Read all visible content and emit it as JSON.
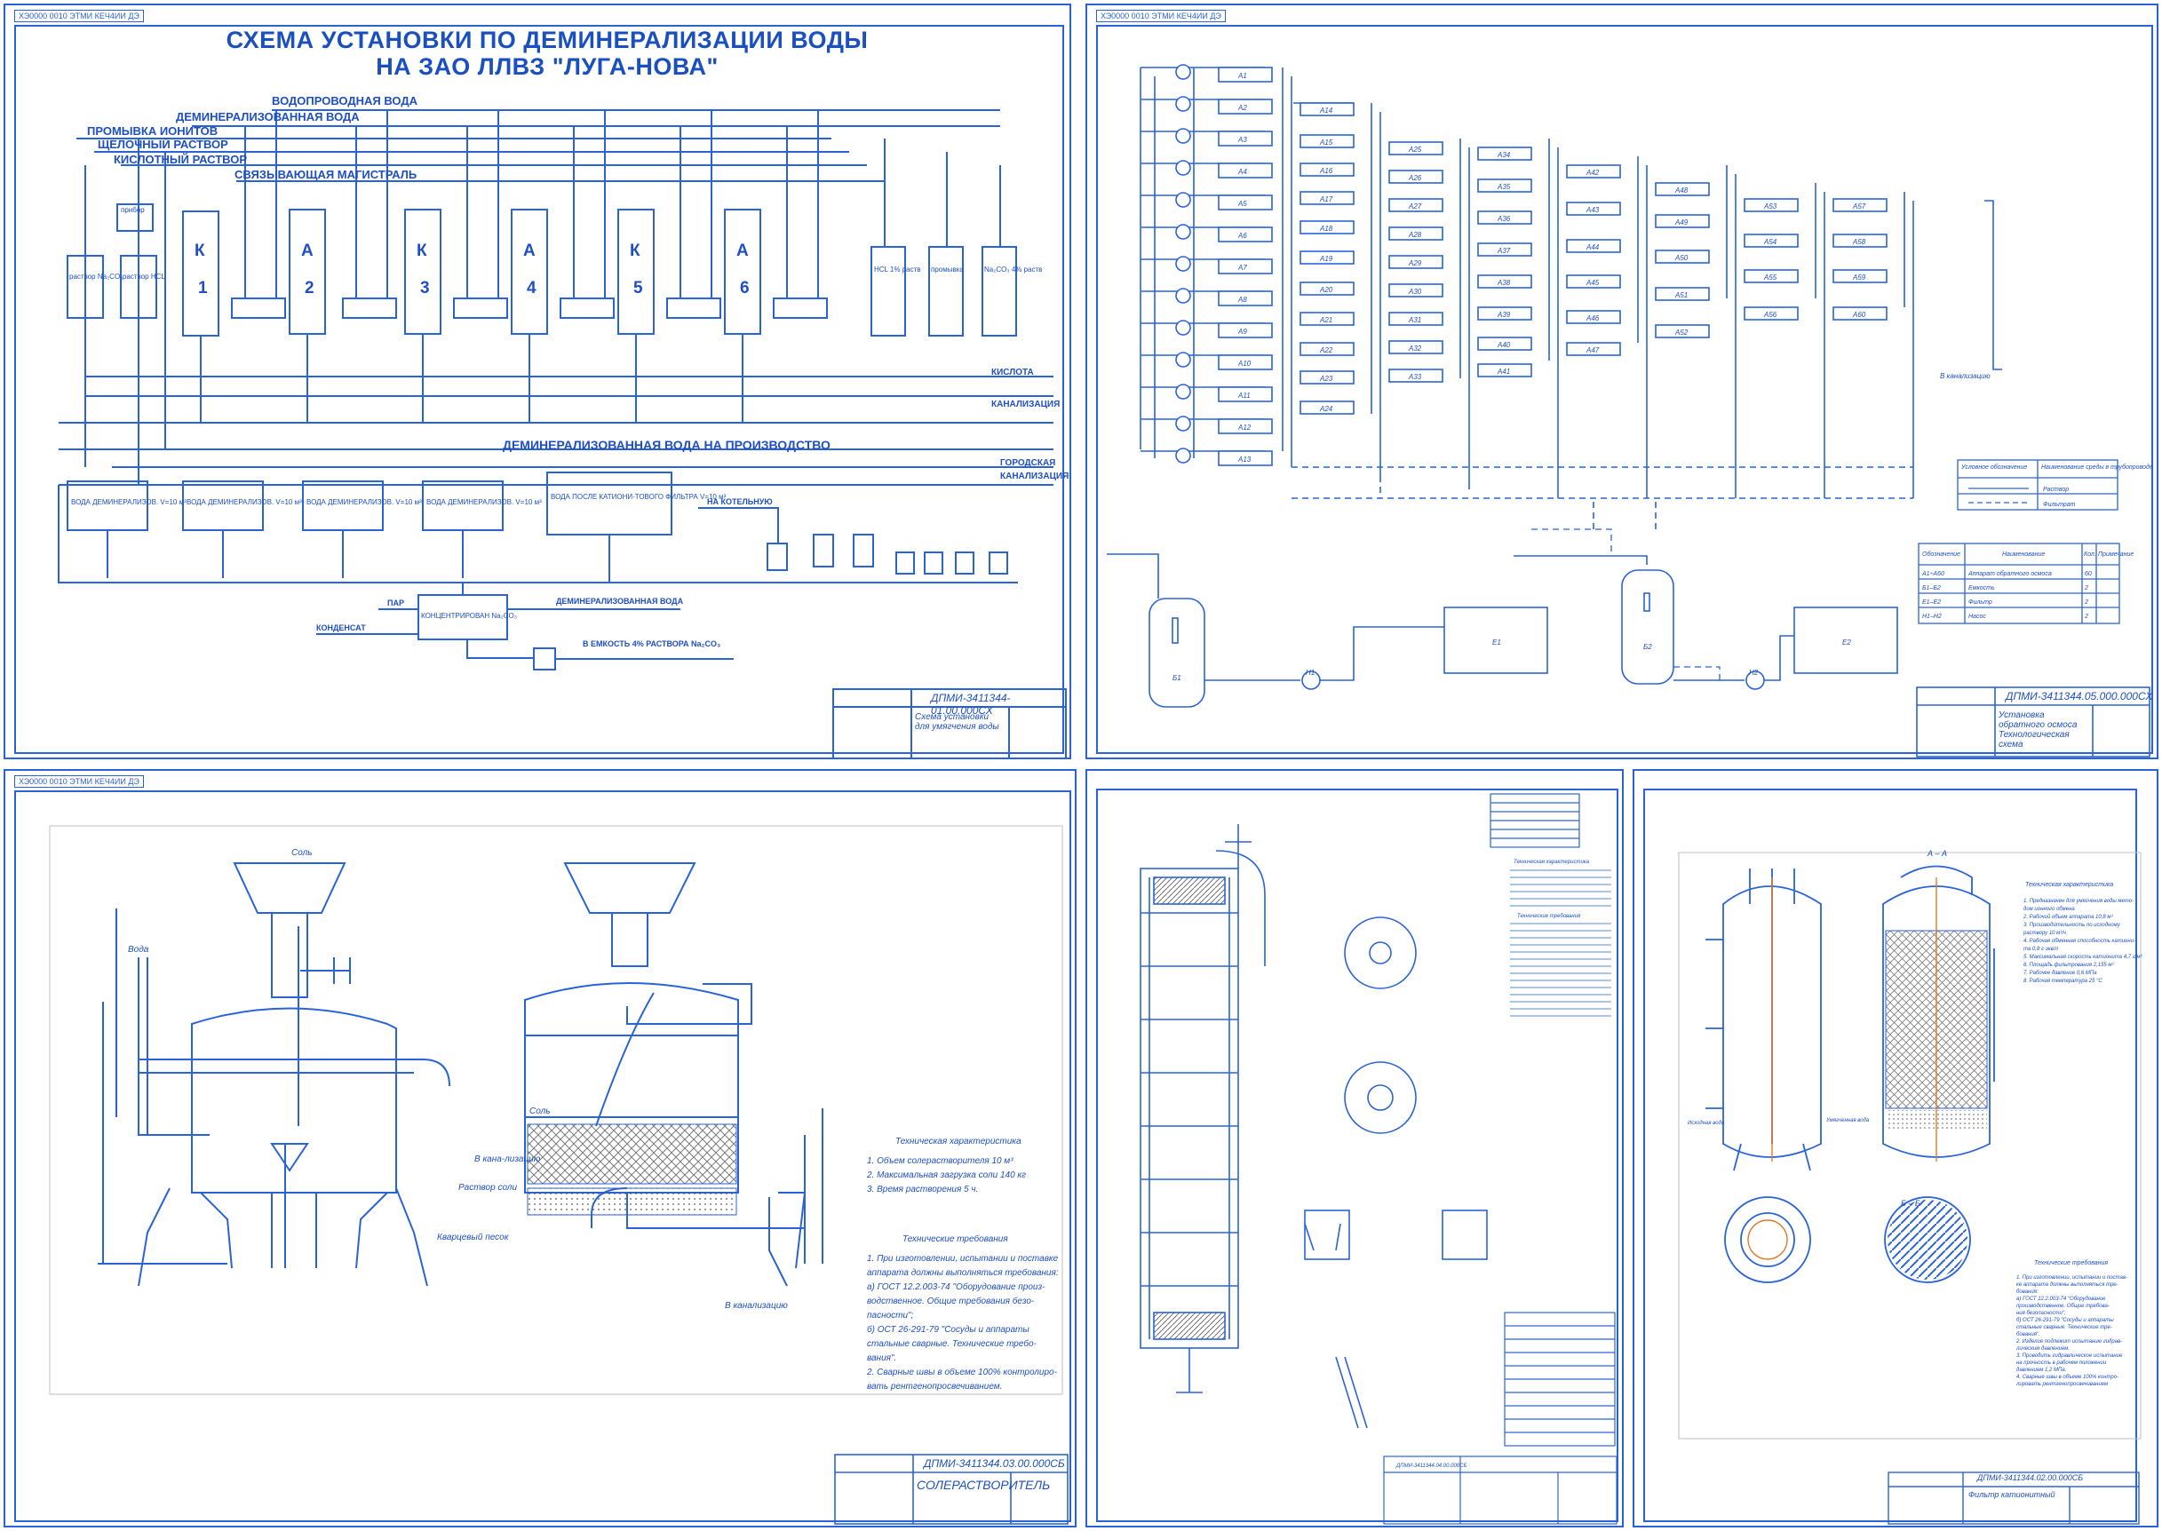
{
  "sheets": [
    {
      "stamp": "ХЭ0000 0010 ЭТМИ КЕЧ4ИИ ДЭ",
      "title_line1": "СХЕМА УСТАНОВКИ ПО ДЕМИНЕРАЛИЗАЦИИ ВОДЫ",
      "title_line2": "НА ЗАО ЛЛВЗ \"ЛУГА-НОВА\"",
      "lines": [
        "ВОДОПРОВОДНАЯ ВОДА",
        "ДЕМИНЕРАЛИЗОВАННАЯ ВОДА",
        "ПРОМЫВКА ИОНИТОВ",
        "ЩЕЛОЧНЫЙ РАСТВОР",
        "КИСЛОТНЫЙ РАСТВОР",
        "СВЯЗЫВАЮЩАЯ МАГИСТРАЛЬ"
      ],
      "columns": [
        "К",
        "1",
        "А",
        "2",
        "К",
        "3",
        "А",
        "4",
        "К",
        "5",
        "А",
        "6"
      ],
      "tanks_left": [
        "прибор",
        "раствор Na₂CO₃",
        "раствор HCL"
      ],
      "tanks_right": [
        "HCL 1% раств",
        "промывка",
        "Na₂CO₃ 4% раств"
      ],
      "kislota": "КИСЛОТА",
      "kanalizaciya": "КАНАЛИЗАЦИЯ",
      "demin_production": "ДЕМИНЕРАЛИЗОВАННАЯ ВОДА НА ПРОИЗВОДСТВО",
      "gorodskaya": "ГОРОДСКАЯ",
      "kanalizaciya2": "КАНАЛИЗАЦИЯ",
      "boxes": [
        "ВОДА ДЕМИНЕРАЛИЗОВ. V=10 м³",
        "ВОДА ДЕМИНЕРАЛИЗОВ. V=10 м³",
        "ВОДА ДЕМИНЕРАЛИЗОВ. V=10 м³",
        "ВОДА ДЕМИНЕРАЛИЗОВ. V=10 м³",
        "ВОДА ПОСЛЕ КАТИОНИ-ТОВОГО ФИЛЬТРА V=10 м³"
      ],
      "na_kotelnuyu": "НА КОТЕЛЬНУЮ",
      "par": "ПАР",
      "konc": "КОНЦЕНТРИРОВАН Na₂CO₃",
      "demin_water": "ДЕМИНЕРАЛИЗОВАННАЯ ВОДА",
      "kondensat": "КОНДЕНСАТ",
      "v_emkost": "В ЕМКОСТЬ 4% РАСТВОРА Na₂CO₃",
      "code": "ДПМИ-3411344-01.00.000СХ",
      "name": "Схема установки для умягчения воды"
    },
    {
      "stamp": "ХЭ0000 0010 ЭТМИ КЕЧ4ИИ ДЭ",
      "units_col1": [
        "А1",
        "А2",
        "А3",
        "А4",
        "А5",
        "А6",
        "А7",
        "А8",
        "А9",
        "А10",
        "А11",
        "А12",
        "А13"
      ],
      "units_col2": [
        "А14",
        "А15",
        "А16",
        "А17",
        "А18",
        "А19",
        "А20",
        "А21",
        "А22",
        "А23",
        "А24"
      ],
      "units_col3": [
        "А25",
        "А26",
        "А27",
        "А28",
        "А29",
        "А30",
        "А31",
        "А32",
        "А33"
      ],
      "units_col4": [
        "А34",
        "А35",
        "А36",
        "А37",
        "А38",
        "А39",
        "А40",
        "А41"
      ],
      "units_col5": [
        "А42",
        "А43",
        "А44",
        "А45",
        "А46",
        "А47"
      ],
      "units_col6": [
        "А48",
        "А49",
        "А50",
        "А51",
        "А52"
      ],
      "units_col7": [
        "А53",
        "А54",
        "А55",
        "А56"
      ],
      "units_col8": [
        "А57",
        "А58",
        "А59",
        "А60"
      ],
      "to_sewer": "В канализацию",
      "legend_head": [
        "Условное обозначение",
        "Наименование среды в трубопроводе"
      ],
      "legend_rows": [
        "Раствор",
        "Фильтрат"
      ],
      "spec_head": [
        "Обозначение",
        "Наименование",
        "Кол.",
        "Примечание"
      ],
      "spec_rows": [
        [
          "А1÷А60",
          "Аппарат обратного осмоса",
          "60"
        ],
        [
          "Б1–Б2",
          "Емкость",
          "2"
        ],
        [
          "Е1–Е2",
          "Фильтр",
          "2"
        ],
        [
          "Н1–Н2",
          "Насос",
          "2"
        ]
      ],
      "equip": [
        "Б1",
        "Н1",
        "Е1",
        "Б2",
        "Н2",
        "Е2"
      ],
      "code": "ДПМИ-3411344.05.000.000СХ",
      "name": "Установка обратного осмоса Технологическая схема"
    },
    {
      "stamp": "ХЭ0000 0010 ЭТМИ КЕЧ4ИИ ДЭ",
      "sol": "Соль",
      "voda": "Вода",
      "v_kanal": "В кана-лизацию",
      "rastvor_soli": "Раствор соли",
      "kvarc": "Кварцевый песок",
      "sol2": "Соль",
      "v_kanal2": "В канализацию",
      "tech_char_title": "Техническая характеристика",
      "tech_char": [
        "1. Объем солерастворителя 10 м³",
        "2. Максимальная загрузка соли 140 кг",
        "3. Время растворения 5 ч."
      ],
      "tech_req_title": "Технические требования",
      "tech_req": [
        "1. При изготовлении, испытании и поставке",
        "аппарата должны выполняться требования:",
        "а) ГОСТ 12.2.003-74 \"Оборудование произ-",
        "водственное. Общие требования безо-",
        "пасности\";",
        "б) ОСТ 26-291-79 \"Сосуды и аппараты",
        "стальные сварные. Технические требо-",
        "вания\".",
        "2. Сварные швы в объеме 100% контролиро-",
        "вать рентгенопросвечиванием."
      ],
      "code": "ДПМИ-3411344.03.00.000СБ",
      "name": "СОЛЕРАСТВОРИТЕЛЬ"
    },
    {
      "tech_title": "Техническая характеристика",
      "tech_req_title": "Технические требования",
      "code": "ДПМИ-3411344.04.00.000СБ"
    },
    {
      "section_aa": "А – А",
      "section_bb": "Б – Б",
      "tech_title": "Техническая характеристика",
      "tech_items": [
        "1. Предназначен для умягчения воды мето-",
        "дом ионного обмена",
        "2. Рабочий объем аппарата 10,8 м³",
        "3. Производительность по исходному",
        "раствору 10 м³/ч",
        "4. Рабочая обменная способность катиони-",
        "та 0,8 г·экв/л",
        "5. Максимальная скорость катионита 4,7 г/м³",
        "6. Площадь фильтрования 2,155 м²",
        "7. Рабочее давление 0,6 МПа",
        "8. Рабочая температура 25 °С"
      ],
      "tech_req_title": "Технические требования",
      "tech_req": [
        "1. При изготовлении, испытании и постав-",
        "ке аппарата должны выполняться тре-",
        "бования:",
        "а) ГОСТ 12.2.003-74 \"Оборудование",
        "производственное. Общие требова-",
        "ния безопасности\";",
        "б) ОСТ 26-291-79 \"Сосуды и аппараты",
        "стальные сварные. Технические тре-",
        "бования\".",
        "2. Изделие подлежит испытанию гидрав-",
        "лическим давлением.",
        "3. Проводить гидравлическое испытание",
        "на прочность в рабочем положении",
        "давлением 1,2 МПа.",
        "4. Сварные швы в объеме 100% контро-",
        "лировать рентгенопросвечиванием"
      ],
      "inlet": "Исходная вода",
      "outlet": "Умягченная вода",
      "code": "ДПМИ-3411344.02.00.000СБ",
      "name": "Фильтр катионитный"
    }
  ],
  "colors": {
    "line": "#2a63d8",
    "text": "#1e4fc4",
    "hatch": "#7b7b7b",
    "accent": "#e07a2a"
  }
}
